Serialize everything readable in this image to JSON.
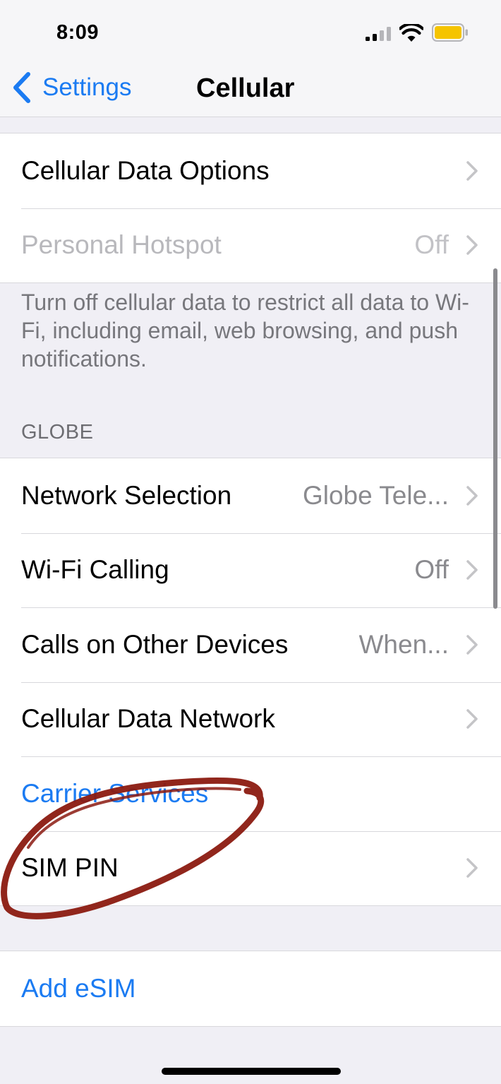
{
  "status_bar": {
    "time": "8:09",
    "battery_color": "#f5c400"
  },
  "nav": {
    "back_label": "Settings",
    "title": "Cellular"
  },
  "group_data": {
    "items": [
      {
        "label": "Cellular Data Options",
        "value": "",
        "enabled": true
      },
      {
        "label": "Personal Hotspot",
        "value": "Off",
        "enabled": false
      }
    ],
    "footer": "Turn off cellular data to restrict all data to Wi-Fi, including email, web browsing, and push notifications."
  },
  "group_carrier": {
    "header": "GLOBE",
    "items": [
      {
        "label": "Network Selection",
        "value": "Globe Tele..."
      },
      {
        "label": "Wi-Fi Calling",
        "value": "Off"
      },
      {
        "label": "Calls on Other Devices",
        "value": "When..."
      },
      {
        "label": "Cellular Data Network",
        "value": ""
      },
      {
        "label": "Carrier Services",
        "value": ""
      },
      {
        "label": "SIM PIN",
        "value": ""
      }
    ]
  },
  "group_esim": {
    "add_label": "Add eSIM"
  },
  "colors": {
    "accent": "#1b7bf2",
    "annotation": "#8b1a10",
    "background": "#f0eff5"
  },
  "annotation": {
    "shape": "hand-drawn ellipse around SIM PIN"
  }
}
